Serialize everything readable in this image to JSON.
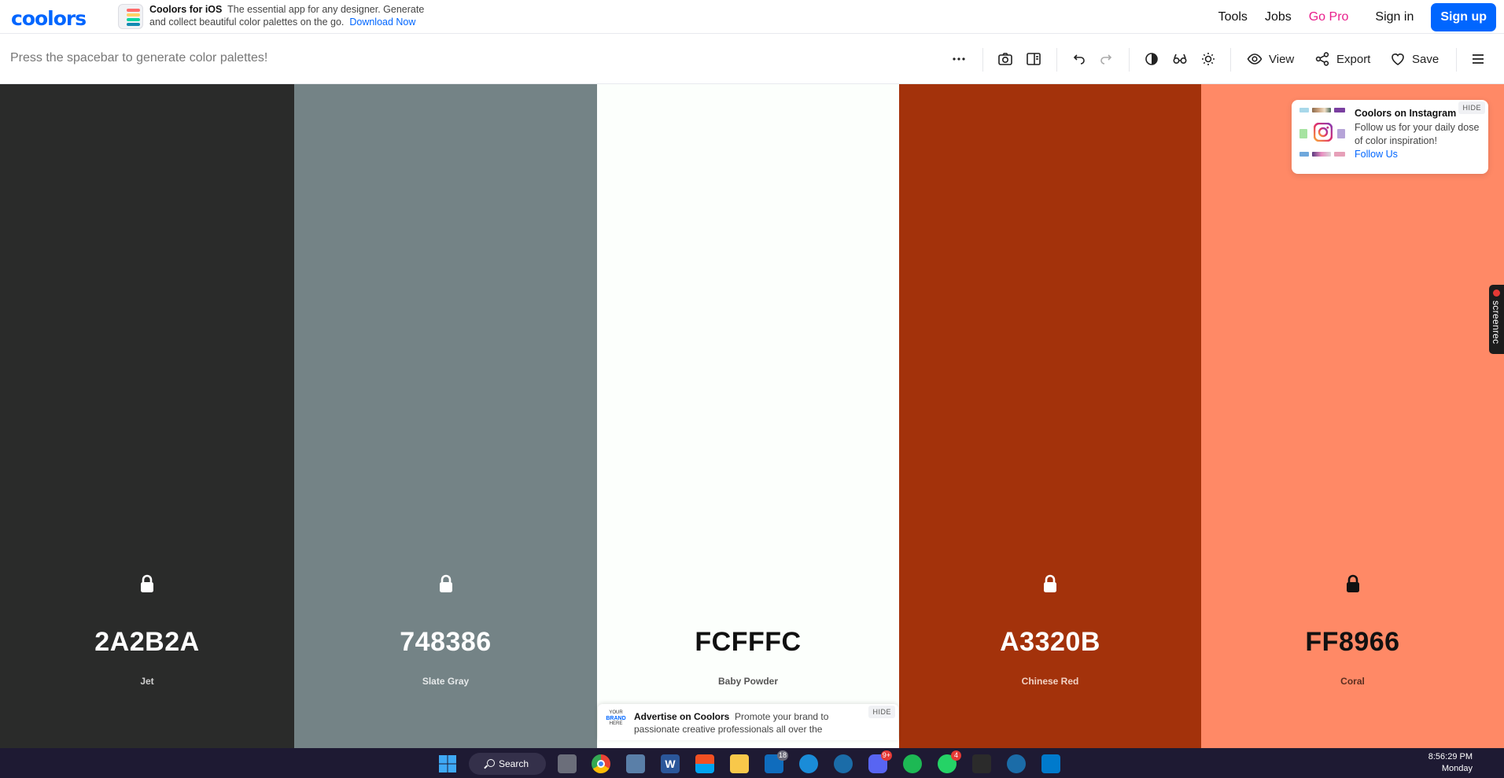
{
  "app": {
    "logo": "coolors"
  },
  "promo": {
    "title": "Coolors for iOS",
    "text": "The essential app for any designer. Generate and collect beautiful color palettes on the go.",
    "link": "Download Now"
  },
  "nav": {
    "tools": "Tools",
    "jobs": "Jobs",
    "go_pro": "Go Pro",
    "sign_in": "Sign in",
    "sign_up": "Sign up"
  },
  "toolbar": {
    "hint": "Press the spacebar to generate color palettes!",
    "view_label": "View",
    "export_label": "Export",
    "save_label": "Save"
  },
  "palette": [
    {
      "hex": "2A2B2A",
      "name": "Jet",
      "bg": "#2A2B2A",
      "fg": "#FFFFFF",
      "name_color": "#D0D0D0"
    },
    {
      "hex": "748386",
      "name": "Slate Gray",
      "bg": "#748386",
      "fg": "#FFFFFF",
      "name_color": "#E6E9EA"
    },
    {
      "hex": "FCFFFC",
      "name": "Baby Powder",
      "bg": "#FCFFFC",
      "fg": "#111111",
      "name_color": "#555555"
    },
    {
      "hex": "A3320B",
      "name": "Chinese Red",
      "bg": "#A3320B",
      "fg": "#FFFFFF",
      "name_color": "#F2D2C5"
    },
    {
      "hex": "FF8966",
      "name": "Coral",
      "bg": "#FF8966",
      "fg": "#111111",
      "name_color": "#5A2E20"
    }
  ],
  "instagram_card": {
    "hide": "HIDE",
    "title": "Coolors on Instagram",
    "text": "Follow us for your daily dose of color inspiration!",
    "link": "Follow Us"
  },
  "ad_card": {
    "hide": "HIDE",
    "logo_line1": "YOUR",
    "logo_line2": "BRAND",
    "logo_line3": "HERE",
    "title": "Advertise on Coolors",
    "text": "Promote your brand to passionate creative professionals all over the"
  },
  "screenrec": {
    "label": "screenrec"
  },
  "taskbar": {
    "search": "Search",
    "badges": {
      "outlook": "18",
      "discord": "9+",
      "whatsapp": "4"
    },
    "time": "8:56:29 PM",
    "day": "Monday"
  },
  "colors": {
    "accent": "#0066ff",
    "pro": "#e91e8c",
    "taskbar": "#1e1a33"
  }
}
